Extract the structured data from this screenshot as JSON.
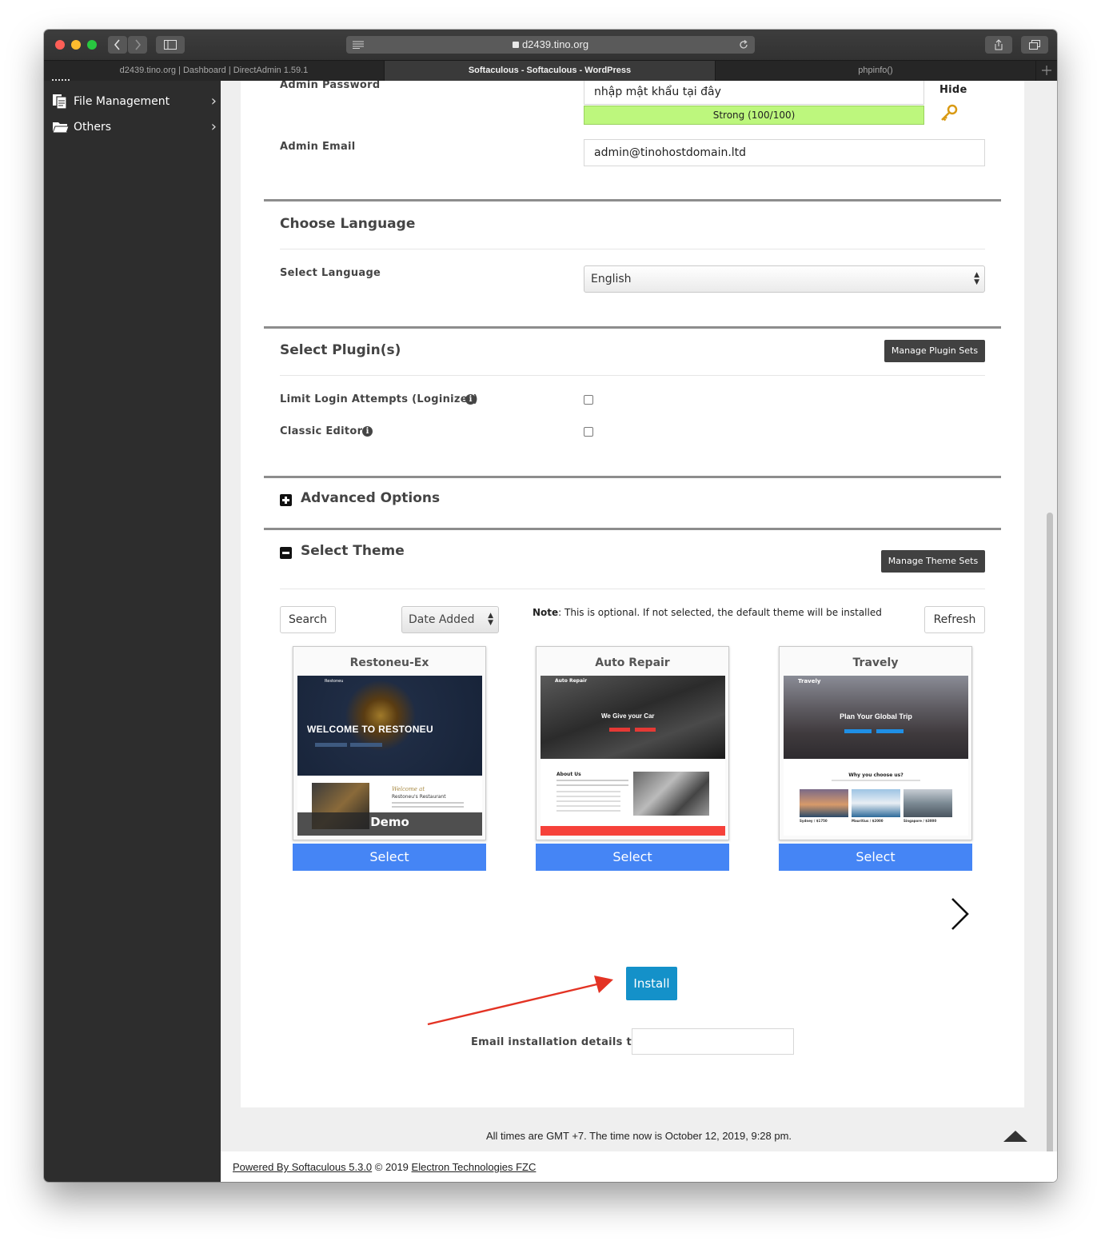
{
  "browser": {
    "url": "d2439.tino.org",
    "tabs": [
      {
        "title": "d2439.tino.org | Dashboard | DirectAdmin 1.59.1",
        "active": false
      },
      {
        "title": "Softaculous - Softaculous - WordPress",
        "active": true
      },
      {
        "title": "phpinfo()",
        "active": false
      }
    ]
  },
  "sidebar": {
    "items": [
      {
        "label": "File Management",
        "icon": "file-icon"
      },
      {
        "label": "Others",
        "icon": "folder-icon"
      }
    ]
  },
  "admin": {
    "password_label": "Admin Password",
    "password_value": "nhập mật khẩu tại đây",
    "strength_text": "Strong (100/100)",
    "hide_label": "Hide",
    "email_label": "Admin Email",
    "email_value": "admin@tinohostdomain.ltd"
  },
  "language": {
    "section_title": "Choose Language",
    "label": "Select Language",
    "selected": "English"
  },
  "plugins": {
    "section_title": "Select Plugin(s)",
    "manage_button": "Manage Plugin Sets",
    "items": [
      {
        "label": "Limit Login Attempts (Loginizer)",
        "checked": false
      },
      {
        "label": "Classic Editor",
        "checked": false
      }
    ]
  },
  "advanced": {
    "section_title": "Advanced Options"
  },
  "theme": {
    "section_title": "Select Theme",
    "manage_button": "Manage Theme Sets",
    "search_button": "Search",
    "sort_selected": "Date Added",
    "note_bold": "Note",
    "note_text": ": This is optional. If not selected, the default theme will be installed",
    "refresh_button": "Refresh",
    "demo_label": "Demo",
    "select_label": "Select",
    "cards": [
      {
        "name": "Restoneu-Ex",
        "nav_brand": "Restoneu",
        "hero_text": "WELCOME TO RESTONEU",
        "subtitle_script": "Welcome at",
        "subtitle": "Restoneu's Restaurant"
      },
      {
        "name": "Auto Repair",
        "nav_brand": "Auto Repair",
        "hero_text": "We Give your Car",
        "about": "About Us"
      },
      {
        "name": "Travely",
        "nav_brand": "Travely",
        "hero_text": "Plan Your Global Trip",
        "why": "Why you choose us?",
        "places": [
          "Sydney / $1750",
          "Mauritius / $2000",
          "Singapore / $3000"
        ]
      }
    ]
  },
  "install": {
    "button": "Install",
    "email_label": "Email installation details to :",
    "email_value": ""
  },
  "footer": {
    "time_note": "All times are GMT +7. The time now is October 12, 2019, 9:28 pm.",
    "powered_link": "Powered By Softaculous 5.3.0",
    "copyright": "© 2019",
    "company_link": "Electron Technologies FZC"
  },
  "colors": {
    "strength_bar": "#bdf77d",
    "select_button": "#4585f5",
    "install_button": "#1491c9",
    "arrow": "#e33324"
  }
}
